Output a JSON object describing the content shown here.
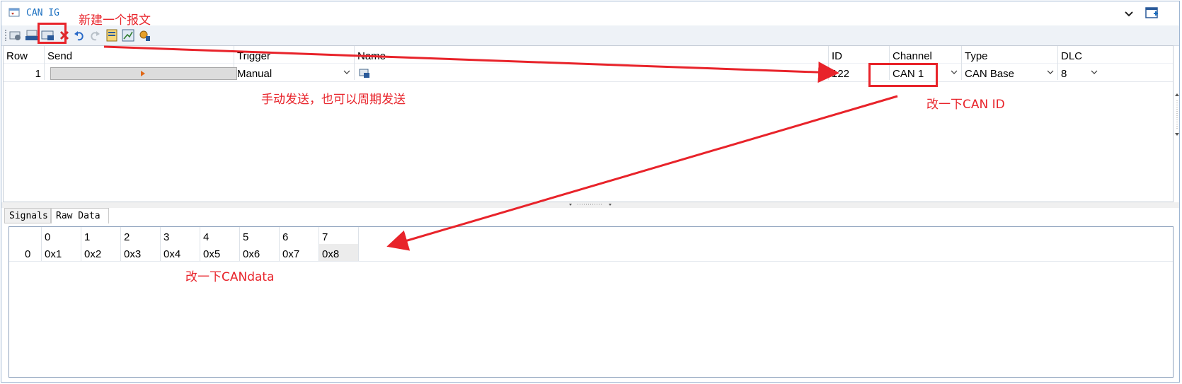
{
  "window": {
    "title": "CAN IG"
  },
  "grid": {
    "headers": [
      "Row",
      "Send",
      "Trigger",
      "Name",
      "ID",
      "Channel",
      "Type",
      "DLC"
    ],
    "row": {
      "row": "1",
      "trigger": "Manual",
      "id": "122",
      "channel": "CAN 1",
      "type": "CAN Base",
      "dlc": "8"
    }
  },
  "tabs": [
    "Signals",
    "Raw Data"
  ],
  "raw_data": {
    "headers": [
      "0",
      "1",
      "2",
      "3",
      "4",
      "5",
      "6",
      "7"
    ],
    "row_label": "0",
    "values": [
      "0x1",
      "0x2",
      "0x3",
      "0x4",
      "0x5",
      "0x6",
      "0x7",
      "0x8"
    ]
  },
  "annotations": {
    "new_message": "新建一个报文",
    "manual_send": "手动发送，也可以周期发送",
    "change_id": "改一下CAN ID",
    "change_data": "改一下CANdata"
  },
  "colors": {
    "annotation": "#e8232a",
    "title": "#1a6fc0"
  }
}
